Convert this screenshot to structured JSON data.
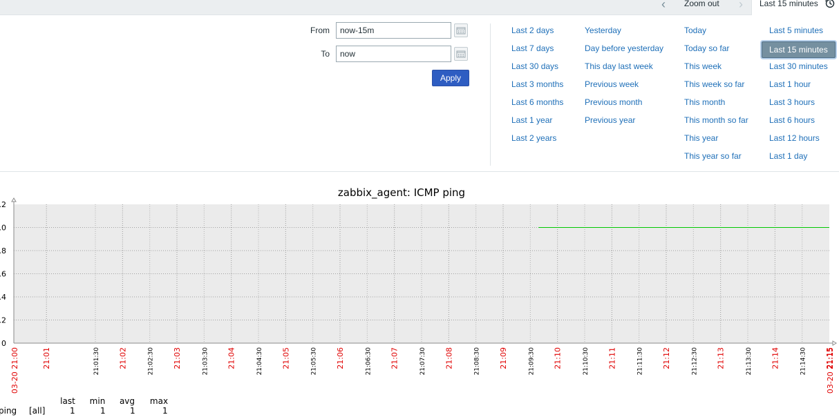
{
  "topbar": {
    "zoom_out_label": "Zoom out",
    "range_label": "Last 15 minutes",
    "icons": {
      "prev": "chevron-left-icon",
      "next": "chevron-right-icon",
      "clock": "clock-icon"
    }
  },
  "filter": {
    "from_label": "From",
    "from_value": "now-15m",
    "to_label": "To",
    "to_value": "now",
    "apply_label": "Apply",
    "quick_ranges": [
      [
        "Last 2 days",
        "Last 7 days",
        "Last 30 days",
        "Last 3 months",
        "Last 6 months",
        "Last 1 year",
        "Last 2 years"
      ],
      [
        "Yesterday",
        "Day before yesterday",
        "This day last week",
        "Previous week",
        "Previous month",
        "Previous year"
      ],
      [
        "Today",
        "Today so far",
        "This week",
        "This week so far",
        "This month",
        "This month so far",
        "This year",
        "This year so far"
      ],
      [
        "Last 5 minutes",
        "Last 15 minutes",
        "Last 30 minutes",
        "Last 1 hour",
        "Last 3 hours",
        "Last 6 hours",
        "Last 12 hours",
        "Last 1 day"
      ]
    ],
    "selected_range": "Last 15 minutes"
  },
  "chart_data": {
    "type": "line",
    "title": "zabbix_agent: ICMP ping",
    "y_tick_labels": [
      ".2",
      ".0",
      ".8",
      ".6",
      ".4",
      ".2",
      "0"
    ],
    "ylim": [
      0,
      1.2
    ],
    "x_tick_labels": [
      "03-20 21:00",
      "21:01",
      "21:01:30",
      "21:02",
      "21:02:30",
      "21:03",
      "21:03:30",
      "21:04",
      "21:04:30",
      "21:05",
      "21:05:30",
      "21:06",
      "21:06:30",
      "21:07",
      "21:07:30",
      "21:08",
      "21:08:30",
      "21:09",
      "21:09:30",
      "21:10",
      "21:10:30",
      "21:11",
      "21:11:30",
      "21:12",
      "21:12:30",
      "21:13",
      "21:13:30",
      "21:14",
      "21:14:30",
      "21:15",
      "03-20 21:15"
    ],
    "x_tick_major": [
      true,
      true,
      false,
      true,
      false,
      true,
      false,
      true,
      false,
      true,
      false,
      true,
      false,
      true,
      false,
      true,
      false,
      true,
      false,
      true,
      false,
      true,
      false,
      true,
      false,
      true,
      false,
      true,
      false,
      true,
      true
    ],
    "x_tick_minutes": [
      0,
      0.6,
      1.5,
      2,
      2.5,
      3,
      3.5,
      4,
      4.5,
      5,
      5.5,
      6,
      6.5,
      7,
      7.5,
      8,
      8.5,
      9,
      9.5,
      10,
      10.5,
      11,
      11.5,
      12,
      12.5,
      13,
      13.5,
      14,
      14.5,
      15,
      15
    ],
    "series": [
      {
        "name": "ping",
        "color": "#00c800",
        "x_minutes": [
          9.65,
          15
        ],
        "y": [
          1,
          1
        ]
      }
    ],
    "grid": true,
    "legend": {
      "headers": [
        "last",
        "min",
        "avg",
        "max"
      ],
      "rows": [
        {
          "name": "ping",
          "func": "[all]",
          "last": "1",
          "min": "1",
          "avg": "1",
          "max": "1"
        }
      ]
    }
  }
}
